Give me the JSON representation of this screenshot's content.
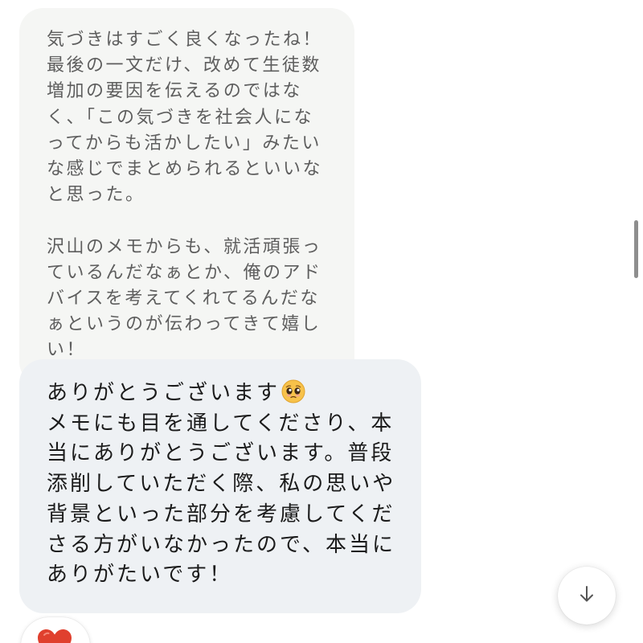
{
  "conversation": {
    "quoted_message": {
      "text": "気づきはすごく良くなったね！\n最後の一文だけ、改めて生徒数\n増加の要因を伝えるのではな\nく、「この気づきを社会人にな\nってからも活かしたい」みたい\nな感じでまとめられるといいな\nと思った。\n\n沢山のメモからも、就活頑張っ\nているんだなぁとか、俺のアド\nバイスを考えてくれてるんだな\nぁというのが伝わってきて嬉し\nい！"
    },
    "reply_message": {
      "first_line": "ありがとうございます",
      "emoji": "pleading-face-icon",
      "rest": "\nメモにも目を通してくださり、本\n当にありがとうございます。普段\n添削していただく際、私の思いや\n背景といった部分を考慮してくだ\nさる方がいなかったので、本当に\nありがたいです！"
    },
    "reaction": {
      "icon": "heart-icon",
      "color": "#e0402e"
    }
  },
  "controls": {
    "scroll_down_icon": "arrow-down-icon"
  },
  "colors": {
    "quoted_bubble_bg": "#f5f6f4",
    "reply_bubble_bg": "#eef1f4"
  }
}
